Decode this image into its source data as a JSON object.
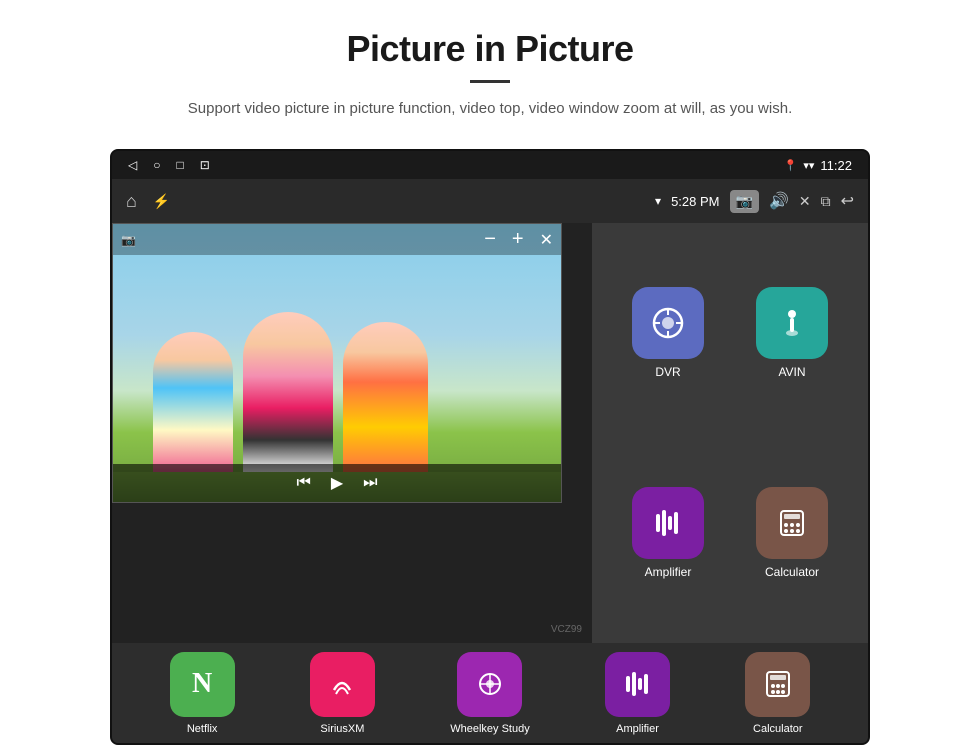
{
  "header": {
    "title": "Picture in Picture",
    "subtitle": "Support video picture in picture function, video top, video window zoom at will, as you wish."
  },
  "status_bar": {
    "time": "11:22",
    "back_icon": "◁",
    "home_icon": "○",
    "recents_icon": "□",
    "media_icon": "⊡"
  },
  "app_bar": {
    "home_icon": "⌂",
    "usb_icon": "⚡",
    "wifi_icon": "▾",
    "time": "5:28 PM",
    "camera_icon": "📷",
    "volume_icon": "🔊",
    "close_icon": "✕",
    "pip_icon": "⧉",
    "back_icon": "↩"
  },
  "pip_window": {
    "camera_icon": "📷",
    "minus_label": "−",
    "plus_label": "+",
    "close_label": "✕"
  },
  "playback": {
    "rewind_icon": "⏮",
    "play_icon": "▶",
    "forward_icon": "⏭"
  },
  "app_grid": [
    {
      "id": "dvr",
      "label": "DVR",
      "color": "bg-blue",
      "icon": "📡"
    },
    {
      "id": "avin",
      "label": "AVIN",
      "color": "bg-teal",
      "icon": "🔌"
    },
    {
      "id": "amplifier",
      "label": "Amplifier",
      "color": "bg-purple2",
      "icon": "🎚"
    },
    {
      "id": "calculator",
      "label": "Calculator",
      "color": "bg-brown",
      "icon": "🖩"
    }
  ],
  "bottom_apps": [
    {
      "id": "netflix",
      "label": "Netflix",
      "color": "bg-green",
      "icon": "N"
    },
    {
      "id": "siriusxm",
      "label": "SiriusXM",
      "color": "bg-pink",
      "icon": "♫"
    },
    {
      "id": "wheelkey",
      "label": "Wheelkey Study",
      "color": "bg-purple",
      "icon": "⊙"
    },
    {
      "id": "amplifier",
      "label": "Amplifier",
      "color": "bg-purple2",
      "icon": "🎚"
    },
    {
      "id": "calculator",
      "label": "Calculator",
      "color": "bg-brown",
      "icon": "🖩"
    }
  ],
  "watermark": "VCZ99"
}
